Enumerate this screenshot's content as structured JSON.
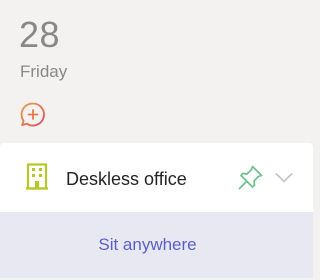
{
  "date": {
    "day_number": "28",
    "weekday": "Friday"
  },
  "add_chat": {
    "icon": "chat-add-icon"
  },
  "location": {
    "label": "Deskless office",
    "icon": "building-icon",
    "pin_icon": "pin-icon",
    "expand_icon": "chevron-down-icon"
  },
  "footer": {
    "action_label": "Sit anywhere"
  },
  "colors": {
    "muted_text": "#8a8886",
    "accent": "#5b5fc7",
    "building_green": "#b5c827",
    "pin_green": "#6fbf8e",
    "chat_orange": "#e07a4a",
    "footer_bg": "#e8e8f2"
  }
}
